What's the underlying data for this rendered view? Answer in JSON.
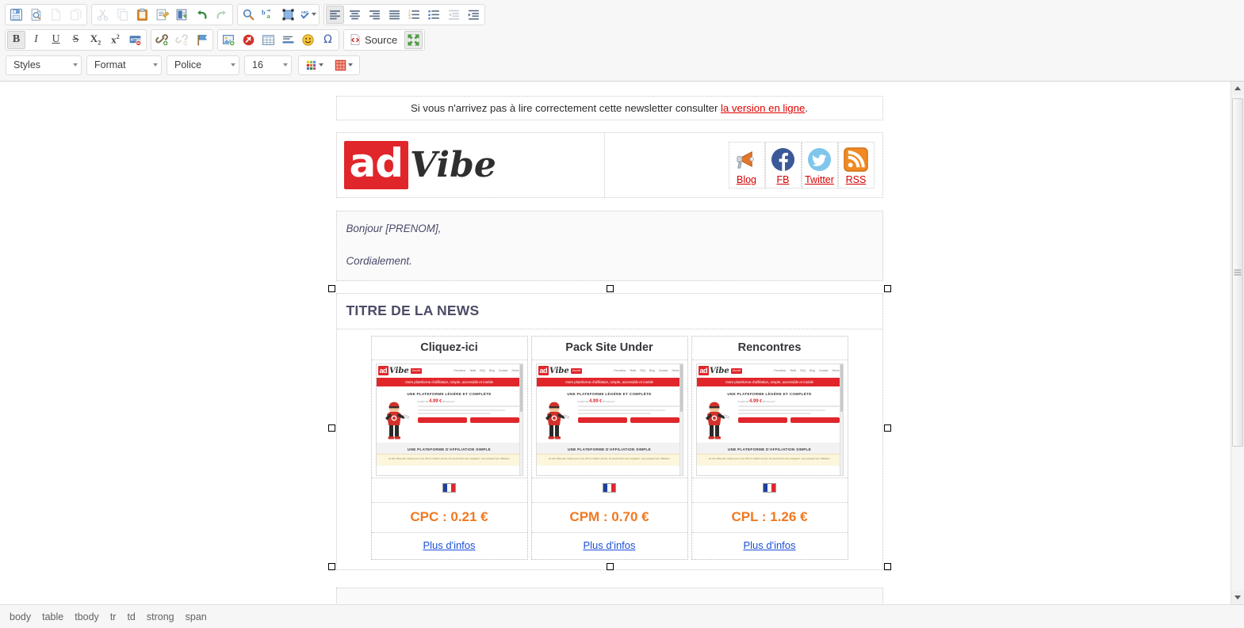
{
  "toolbar": {
    "groups_row1": [
      {
        "name": "document",
        "buttons": [
          {
            "name": "save",
            "icon": "save-icon",
            "state": "enabled"
          },
          {
            "name": "preview",
            "icon": "preview-icon",
            "state": "enabled"
          },
          {
            "name": "new-page",
            "icon": "new-page-icon",
            "state": "disabled"
          },
          {
            "name": "templates",
            "icon": "templates-icon",
            "state": "disabled"
          }
        ]
      },
      {
        "name": "clipboard",
        "buttons": [
          {
            "name": "cut",
            "icon": "scissors-icon",
            "state": "disabled"
          },
          {
            "name": "copy",
            "icon": "copy-icon",
            "state": "disabled"
          },
          {
            "name": "paste",
            "icon": "paste-icon",
            "state": "enabled"
          },
          {
            "name": "paste-as-text",
            "icon": "paste-text-icon",
            "state": "enabled"
          },
          {
            "name": "paste-from-word",
            "icon": "paste-word-icon",
            "state": "enabled"
          },
          {
            "name": "undo",
            "icon": "undo-icon",
            "state": "enabled"
          },
          {
            "name": "redo",
            "icon": "redo-icon",
            "state": "disabled"
          }
        ]
      },
      {
        "name": "editing",
        "buttons": [
          {
            "name": "find",
            "icon": "magnifier-icon",
            "state": "enabled"
          },
          {
            "name": "replace",
            "icon": "replace-icon",
            "state": "enabled"
          },
          {
            "name": "select-all",
            "icon": "select-all-icon",
            "state": "enabled"
          },
          {
            "name": "spellcheck",
            "icon": "spellcheck-icon",
            "state": "enabled",
            "has_arrow": true
          }
        ]
      },
      {
        "name": "paragraph",
        "buttons": [
          {
            "name": "align-left",
            "icon": "align-left-icon",
            "state": "active"
          },
          {
            "name": "align-center",
            "icon": "align-center-icon",
            "state": "enabled"
          },
          {
            "name": "align-right",
            "icon": "align-right-icon",
            "state": "enabled"
          },
          {
            "name": "align-justify",
            "icon": "align-justify-icon",
            "state": "enabled"
          },
          {
            "name": "numbered-list",
            "icon": "numbered-list-icon",
            "state": "enabled"
          },
          {
            "name": "bulleted-list",
            "icon": "bulleted-list-icon",
            "state": "enabled"
          },
          {
            "name": "outdent",
            "icon": "outdent-icon",
            "state": "disabled"
          },
          {
            "name": "indent",
            "icon": "indent-icon",
            "state": "enabled"
          }
        ]
      }
    ],
    "groups_row2": [
      {
        "name": "basic-styles",
        "buttons": [
          {
            "name": "bold",
            "icon": "bold-icon",
            "label": "B",
            "state": "active"
          },
          {
            "name": "italic",
            "icon": "italic-icon",
            "label": "I",
            "state": "enabled"
          },
          {
            "name": "underline",
            "icon": "underline-icon",
            "label": "U",
            "state": "enabled"
          },
          {
            "name": "strikethrough",
            "icon": "strikethrough-icon",
            "label": "S",
            "state": "enabled"
          },
          {
            "name": "subscript",
            "icon": "subscript-icon",
            "label": "X",
            "state": "enabled"
          },
          {
            "name": "superscript",
            "icon": "superscript-icon",
            "label": "x",
            "state": "enabled"
          },
          {
            "name": "remove-format",
            "icon": "remove-format-icon",
            "state": "enabled"
          }
        ]
      },
      {
        "name": "links",
        "buttons": [
          {
            "name": "link",
            "icon": "link-icon",
            "state": "enabled"
          },
          {
            "name": "unlink",
            "icon": "unlink-icon",
            "state": "disabled"
          },
          {
            "name": "anchor",
            "icon": "anchor-flag-icon",
            "state": "enabled"
          }
        ]
      },
      {
        "name": "insert",
        "buttons": [
          {
            "name": "image",
            "icon": "image-icon",
            "state": "enabled"
          },
          {
            "name": "flash",
            "icon": "flash-icon",
            "state": "enabled"
          },
          {
            "name": "table",
            "icon": "table-icon",
            "state": "enabled"
          },
          {
            "name": "horizontal-rule",
            "icon": "horizontal-rule-icon",
            "state": "enabled"
          },
          {
            "name": "smiley",
            "icon": "smiley-icon",
            "state": "enabled"
          },
          {
            "name": "special-char",
            "icon": "omega-icon",
            "label": "Ω",
            "state": "enabled"
          }
        ]
      }
    ],
    "source_label": "Source",
    "maximize_name": "maximize-icon",
    "combos": [
      {
        "name": "styles",
        "label": "Styles"
      },
      {
        "name": "format",
        "label": "Format"
      },
      {
        "name": "font",
        "label": "Police"
      },
      {
        "name": "font-size",
        "label": "16"
      }
    ],
    "color_buttons": [
      {
        "name": "text-color",
        "icon": "text-color-icon"
      },
      {
        "name": "background-color",
        "icon": "bg-color-icon"
      }
    ]
  },
  "newsletter": {
    "preheader": {
      "text_before": "Si vous n'arrivez pas à lire correctement cette newsletter consulter ",
      "link": "la version en ligne",
      "text_after": "."
    },
    "logo": {
      "mark": "ad",
      "word": "Vibe"
    },
    "social": [
      {
        "name": "blog",
        "label": "Blog",
        "icon": "megaphone-icon"
      },
      {
        "name": "facebook",
        "label": "FB",
        "icon": "facebook-icon"
      },
      {
        "name": "twitter",
        "label": "Twitter",
        "icon": "twitter-icon"
      },
      {
        "name": "rss",
        "label": "RSS",
        "icon": "rss-icon"
      }
    ],
    "body": {
      "greeting": "Bonjour [PRENOM],",
      "signoff": "Cordialement."
    },
    "news": {
      "title": "TITRE DE LA NEWS",
      "cards": [
        {
          "title": "Cliquez-ici",
          "flag": "fr-flag-icon",
          "price": "CPC : 0.21 €",
          "more": "Plus d'infos"
        },
        {
          "title": "Pack Site Under",
          "flag": "fr-flag-icon",
          "price": "CPM : 0.70 €",
          "more": "Plus d'infos"
        },
        {
          "title": "Rencontres",
          "flag": "fr-flag-icon",
          "price": "CPL : 1.26 €",
          "more": "Plus d'infos"
        }
      ]
    },
    "screenshot": {
      "logo_mark": "ad",
      "logo_word": "Vibe",
      "home_label": "Accueil",
      "nav": [
        "Fonctions",
        "Tarifs",
        "FAQ",
        "Blog",
        "Contact",
        "Demo"
      ],
      "band": "Votre plateforme d'affiliation, simple, accessible et mobile",
      "heading1": "UNE PLATEFORME LÉGÈRE ET COMPLÈTE",
      "price_prefix": "A partir de",
      "price": "4.99",
      "price_currency": "€",
      "price_suffix": "HT par jour !",
      "buttons": [
        "Démonstration en vidéo",
        "Démonstration en ligne"
      ],
      "heading2": "UNE PLATEFORME D'AFFILIATION SIMPLE",
      "cookie": "Ce site utilise des cookies pour vous offrir le meilleur service. En poursuivant votre navigation, vous acceptez leur utilisation.",
      "cookie_link": "J'accepte En savoir plus"
    }
  },
  "statusbar": {
    "path": [
      "body",
      "table",
      "tbody",
      "tr",
      "td",
      "strong",
      "span"
    ]
  },
  "colors": {
    "brand_red": "#e0262b",
    "price_orange": "#f07820",
    "link_blue": "#1b4fd8",
    "link_red": "#d40000",
    "title_slate": "#4c4c68"
  }
}
